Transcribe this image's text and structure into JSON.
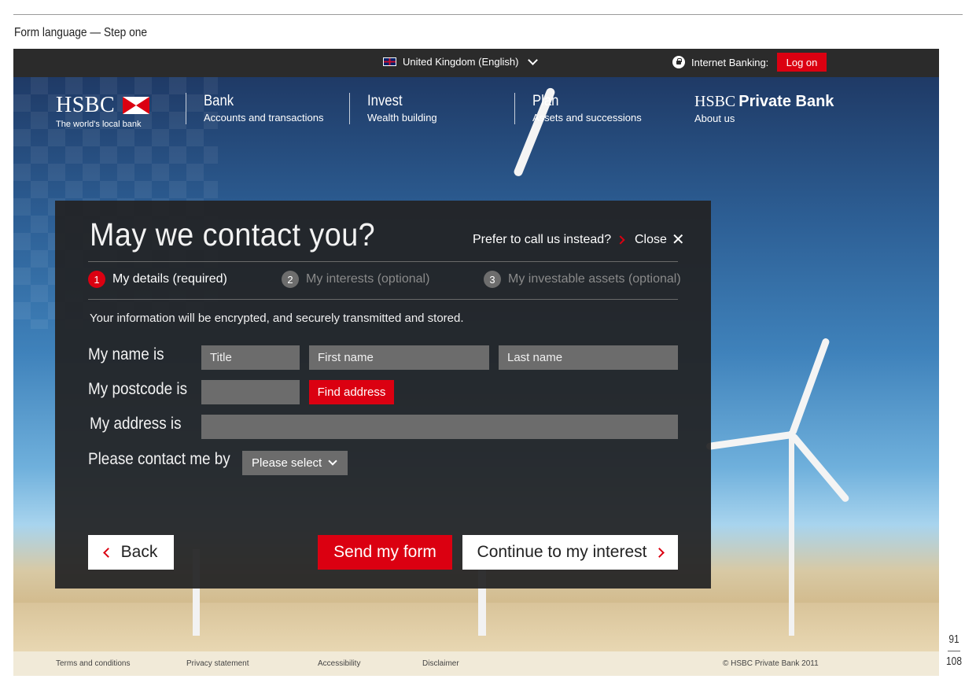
{
  "doc": {
    "caption": "Form language — Step one",
    "page_current": "91",
    "page_total": "108"
  },
  "topbar": {
    "region": "United Kingdom (English)",
    "internet_banking": "Internet Banking:",
    "logon": "Log on"
  },
  "nav": {
    "logo": "HSBC",
    "tagline": "The world's local bank",
    "items": [
      {
        "title": "Bank",
        "sub": "Accounts and transactions"
      },
      {
        "title": "Invest",
        "sub": "Wealth building"
      },
      {
        "title": "Plan",
        "sub": "Assets and successions"
      }
    ],
    "private_bank": {
      "hsbc": "HSBC",
      "title": "Private Bank",
      "sub": "About us"
    }
  },
  "modal": {
    "title": "May we contact you?",
    "call_us": "Prefer to call us instead?",
    "close": "Close",
    "steps": [
      {
        "num": "1",
        "label": "My details (required)"
      },
      {
        "num": "2",
        "label": "My interests (optional)"
      },
      {
        "num": "3",
        "label": "My investable assets (optional)"
      }
    ],
    "notice": "Your information will be encrypted, and securely transmitted and stored.",
    "form": {
      "name_label": "My name is",
      "title_placeholder": "Title",
      "first_name_placeholder": "First name",
      "last_name_placeholder": "Last name",
      "postcode_label": "My postcode is",
      "postcode_placeholder": "",
      "find_address": "Find address",
      "address_label": "My address is",
      "address_placeholder": "",
      "contact_label": "Please contact me by",
      "contact_select": "Please select"
    },
    "buttons": {
      "back": "Back",
      "send": "Send my form",
      "continue": "Continue to my interest"
    }
  },
  "footer": {
    "terms": "Terms and conditions",
    "privacy": "Privacy statement",
    "accessibility": "Accessibility",
    "disclaimer": "Disclaimer",
    "copyright": "© HSBC Private Bank 2011"
  },
  "colors": {
    "brand_red": "#db0011",
    "topbar": "#2b2b2b",
    "field_gray": "#6c6c6c"
  }
}
